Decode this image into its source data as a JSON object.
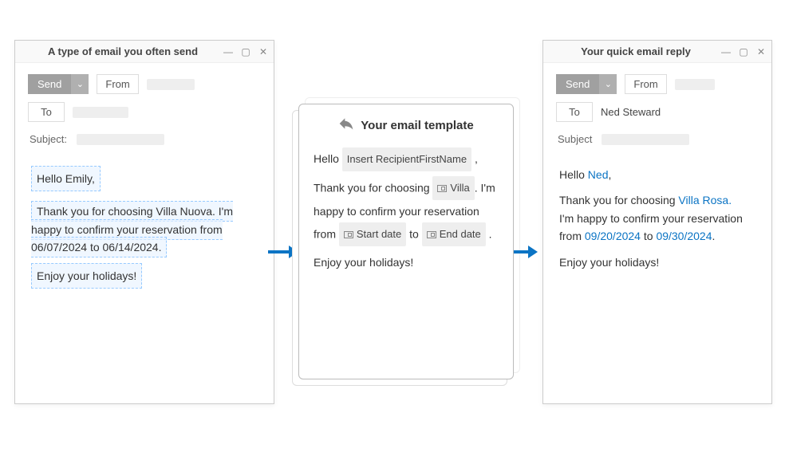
{
  "left": {
    "title": "A type of email you often send",
    "send": "Send",
    "from": "From",
    "to": "To",
    "subject_label": "Subject:",
    "body": {
      "line1": "Hello Emily,",
      "line2": "Thank you for choosing Villa Nuova. I'm happy to confirm your reservation from 06/07/2024 to 06/14/2024.",
      "line3": "Enjoy your holidays!"
    }
  },
  "template": {
    "title": "Your email template",
    "hello_prefix": "Hello",
    "hello_ph": "Insert RecipientFirstName",
    "hello_suffix": ",",
    "l2a": "Thank you for choosing",
    "l2_villa_ph": "Villa",
    "l2b": ". I'm happy to confirm your reservation",
    "l3a": "from",
    "l3_start_ph": "Start date",
    "l3b": "to",
    "l3_end_ph": "End date",
    "l3c": ".",
    "l4": "Enjoy your holidays!"
  },
  "right": {
    "title": "Your quick email reply",
    "send": "Send",
    "from": "From",
    "to": "To",
    "to_value": "Ned Steward",
    "subject_label": "Subject",
    "body": {
      "l1a": "Hello ",
      "l1_name": "Ned",
      "l1b": ",",
      "l2a": "Thank you for choosing ",
      "l2_villa": "Villa Rosa.",
      "l3": "I'm happy to confirm your reservation",
      "l4a": "from ",
      "l4_d1": "09/20/2024",
      "l4b": " to ",
      "l4_d2": "09/30/2024",
      "l4c": ".",
      "l5": "Enjoy your holidays!"
    }
  }
}
